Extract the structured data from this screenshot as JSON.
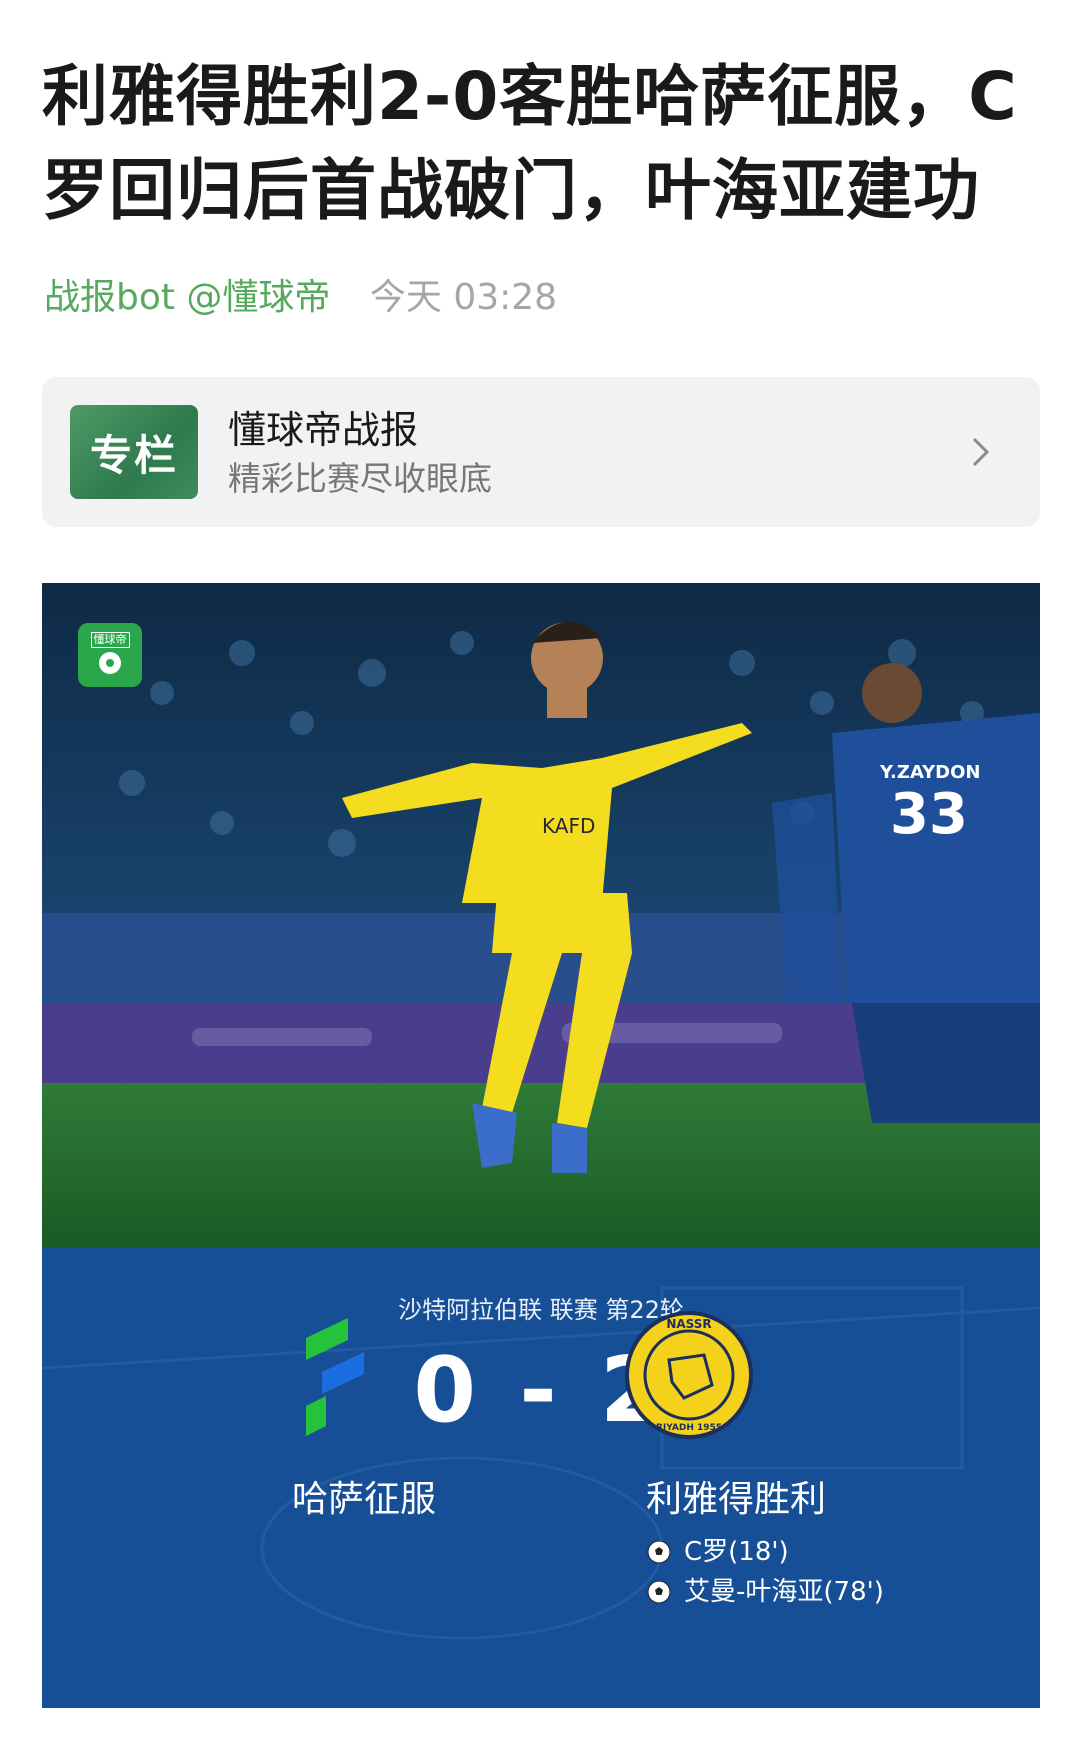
{
  "article": {
    "title": "利雅得胜利2-0客胜哈萨征服，C罗回归后首战破门，叶海亚建功",
    "author": "战报bot @懂球帝",
    "time": "今天 03:28"
  },
  "column": {
    "badge": "专栏",
    "title": "懂球帝战报",
    "subtitle": "精彩比赛尽收眼底"
  },
  "hero": {
    "watermark": "懂球帝",
    "kit_sponsor": "KAFD",
    "opponent_name_on_shirt": "Y.ZAYDON",
    "opponent_number": "33"
  },
  "match": {
    "league": "沙特阿拉伯联 联赛 第22轮",
    "score": "0 - 2",
    "home_team": "哈萨征服",
    "away_team": "利雅得胜利",
    "away_badge_top": "NASSR",
    "away_badge_bottom": "RIYADH 1955",
    "scorers": [
      {
        "name": "C罗(18')"
      },
      {
        "name": "艾曼-叶海亚(78')"
      }
    ]
  },
  "colors": {
    "author_green": "#57a95f",
    "panel_blue": "#164f96",
    "kit_yellow": "#f4dd1e"
  }
}
